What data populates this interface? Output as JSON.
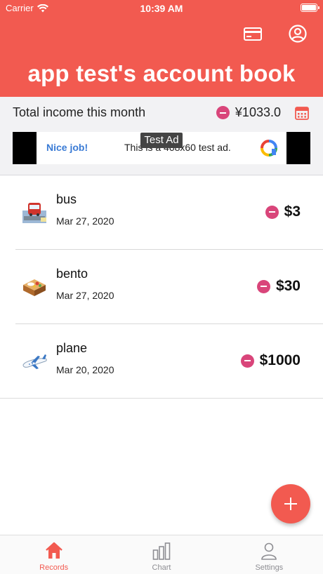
{
  "status_bar": {
    "carrier": "Carrier",
    "time": "10:39 AM"
  },
  "header": {
    "title": "app test's account book",
    "actions": [
      {
        "icon": "credit-card-icon"
      },
      {
        "icon": "account-circle-icon"
      }
    ],
    "background_color": "#f25a50"
  },
  "summary": {
    "label": "Total income this month",
    "amount": "¥1033.0",
    "sign_icon": "minus-circle-icon",
    "calendar_icon": "calendar-icon"
  },
  "ad": {
    "badge": "Test Ad",
    "headline": "Nice job!",
    "text": "This is a 468x60 test ad."
  },
  "records": [
    {
      "name": "bus",
      "date": "Mar 27, 2020",
      "amount": "$3",
      "icon": "bus-icon"
    },
    {
      "name": "bento",
      "date": "Mar 27, 2020",
      "amount": "$30",
      "icon": "bento-icon"
    },
    {
      "name": "plane",
      "date": "Mar 20, 2020",
      "amount": "$1000",
      "icon": "plane-icon"
    }
  ],
  "fab": {
    "icon": "plus-icon"
  },
  "tabs": [
    {
      "label": "Records",
      "icon": "home-icon",
      "active": true
    },
    {
      "label": "Chart",
      "icon": "bar-chart-icon",
      "active": false
    },
    {
      "label": "Settings",
      "icon": "person-icon",
      "active": false
    }
  ],
  "colors": {
    "accent": "#f25a50",
    "expense_dot": "#d9457a",
    "ad_link": "#3a7bd5"
  }
}
